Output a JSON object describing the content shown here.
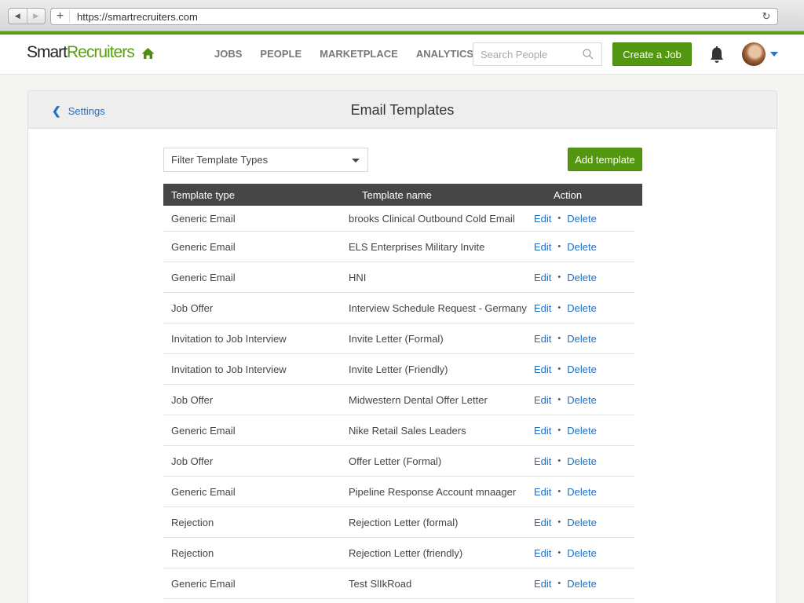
{
  "browser": {
    "url": "https://smartrecruiters.com",
    "back_icon": "triangle-left",
    "forward_icon": "triangle-right",
    "new_tab_icon": "+",
    "reload_icon": "↻"
  },
  "header": {
    "logo_part1": "Smart",
    "logo_part2": "Recruiters",
    "nav": [
      "JOBS",
      "PEOPLE",
      "MARKETPLACE",
      "ANALYTICS"
    ],
    "search_placeholder": "Search People",
    "create_job_label": "Create a Job",
    "colors": {
      "brand_green": "#5a9e13",
      "link_blue": "#1f6fc6"
    }
  },
  "panel": {
    "back_label": "Settings",
    "title": "Email Templates",
    "filter_label": "Filter Template Types",
    "add_template_label": "Add template"
  },
  "table": {
    "columns": [
      "Template type",
      "Template name",
      "Action"
    ],
    "edit_label": "Edit",
    "separator": "•",
    "delete_label": "Delete",
    "rows": [
      {
        "type": "Generic Email",
        "name": "brooks Clinical Outbound Cold Email"
      },
      {
        "type": "Generic Email",
        "name": "ELS Enterprises Military Invite"
      },
      {
        "type": "Generic Email",
        "name": "HNI"
      },
      {
        "type": "Job Offer",
        "name": "Interview Schedule Request - Germany"
      },
      {
        "type": "Invitation to Job Interview",
        "name": "Invite Letter (Formal)"
      },
      {
        "type": "Invitation to Job Interview",
        "name": "Invite Letter (Friendly)"
      },
      {
        "type": "Job Offer",
        "name": "Midwestern Dental Offer Letter"
      },
      {
        "type": "Generic Email",
        "name": "Nike Retail Sales Leaders"
      },
      {
        "type": "Job Offer",
        "name": "Offer Letter (Formal)"
      },
      {
        "type": "Generic Email",
        "name": "Pipeline Response Account mnaager"
      },
      {
        "type": "Rejection",
        "name": "Rejection Letter (formal)"
      },
      {
        "type": "Rejection",
        "name": "Rejection Letter (friendly)"
      },
      {
        "type": "Generic Email",
        "name": "Test SlIkRoad"
      }
    ]
  }
}
